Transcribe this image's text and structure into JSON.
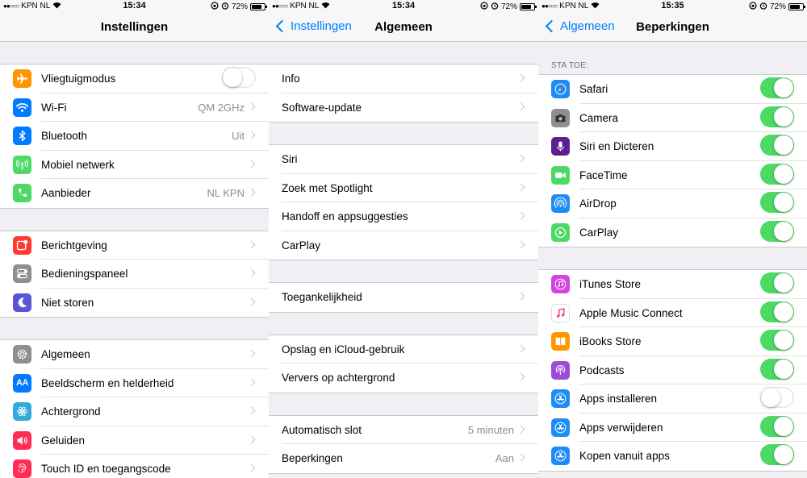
{
  "statusbar": [
    {
      "carrier": "KPN NL",
      "time": "15:34",
      "battery": "72%"
    },
    {
      "carrier": "KPN NL",
      "time": "15:34",
      "battery": "72%"
    },
    {
      "carrier": "KPN NL",
      "time": "15:35",
      "battery": "72%"
    }
  ],
  "screen1": {
    "title": "Instellingen",
    "groups": [
      [
        {
          "label": "Vliegtuigmodus",
          "icon": "airplane-icon",
          "color": "#ff9500",
          "toggle": "off"
        },
        {
          "label": "Wi-Fi",
          "icon": "wifi-icon",
          "color": "#007aff",
          "value": "QM 2GHz"
        },
        {
          "label": "Bluetooth",
          "icon": "bluetooth-icon",
          "color": "#007aff",
          "value": "Uit"
        },
        {
          "label": "Mobiel netwerk",
          "icon": "antenna-icon",
          "color": "#4cd964"
        },
        {
          "label": "Aanbieder",
          "icon": "phone-icon",
          "color": "#4cd964",
          "value": "NL KPN"
        }
      ],
      [
        {
          "label": "Berichtgeving",
          "icon": "notifications-icon",
          "color": "#ff3b30"
        },
        {
          "label": "Bedieningspaneel",
          "icon": "control-center-icon",
          "color": "#8e8e93"
        },
        {
          "label": "Niet storen",
          "icon": "moon-icon",
          "color": "#5856d6"
        }
      ],
      [
        {
          "label": "Algemeen",
          "icon": "gear-icon",
          "color": "#8e8e93"
        },
        {
          "label": "Beeldscherm en helderheid",
          "icon": "text-size-icon",
          "color": "#007aff"
        },
        {
          "label": "Achtergrond",
          "icon": "wallpaper-icon",
          "color": "#34aadc"
        },
        {
          "label": "Geluiden",
          "icon": "speaker-icon",
          "color": "#ff2d55"
        },
        {
          "label": "Touch ID en toegangscode",
          "icon": "fingerprint-icon",
          "color": "#ff2d55"
        }
      ]
    ]
  },
  "screen2": {
    "back": "Instellingen",
    "title": "Algemeen",
    "groups": [
      [
        {
          "label": "Info"
        },
        {
          "label": "Software-update"
        }
      ],
      [
        {
          "label": "Siri"
        },
        {
          "label": "Zoek met Spotlight"
        },
        {
          "label": "Handoff en appsuggesties"
        },
        {
          "label": "CarPlay"
        }
      ],
      [
        {
          "label": "Toegankelijkheid"
        }
      ],
      [
        {
          "label": "Opslag en iCloud-gebruik"
        },
        {
          "label": "Ververs op achtergrond"
        }
      ],
      [
        {
          "label": "Automatisch slot",
          "value": "5 minuten"
        },
        {
          "label": "Beperkingen",
          "value": "Aan"
        }
      ]
    ]
  },
  "screen3": {
    "back": "Algemeen",
    "title": "Beperkingen",
    "section_header": "STA TOE:",
    "groups": [
      [
        {
          "label": "Safari",
          "icon": "compass-icon",
          "color": "#1e8cf5",
          "toggle": "on"
        },
        {
          "label": "Camera",
          "icon": "camera-icon",
          "color": "#8e8e93",
          "toggle": "on"
        },
        {
          "label": "Siri en Dicteren",
          "icon": "microphone-icon",
          "color": "#5d1f8f",
          "toggle": "on"
        },
        {
          "label": "FaceTime",
          "icon": "video-camera-icon",
          "color": "#4cd964",
          "toggle": "on"
        },
        {
          "label": "AirDrop",
          "icon": "airdrop-icon",
          "color": "#1e8cf5",
          "toggle": "on"
        },
        {
          "label": "CarPlay",
          "icon": "carplay-icon",
          "color": "#4cd964",
          "toggle": "on"
        }
      ],
      [
        {
          "label": "iTunes Store",
          "icon": "music-note-icon",
          "color": "#d243e0",
          "toggle": "on"
        },
        {
          "label": "Apple Music Connect",
          "icon": "music-connect-icon",
          "color": "#ffffff",
          "toggle": "on"
        },
        {
          "label": "iBooks Store",
          "icon": "book-icon",
          "color": "#ff9500",
          "toggle": "on"
        },
        {
          "label": "Podcasts",
          "icon": "podcast-icon",
          "color": "#9b4bd6",
          "toggle": "on"
        },
        {
          "label": "Apps installeren",
          "icon": "app-store-icon",
          "color": "#1e8cf5",
          "toggle": "off"
        },
        {
          "label": "Apps verwijderen",
          "icon": "app-store-icon",
          "color": "#1e8cf5",
          "toggle": "on"
        },
        {
          "label": "Kopen vanuit apps",
          "icon": "app-store-icon",
          "color": "#1e8cf5",
          "toggle": "on"
        }
      ]
    ]
  }
}
